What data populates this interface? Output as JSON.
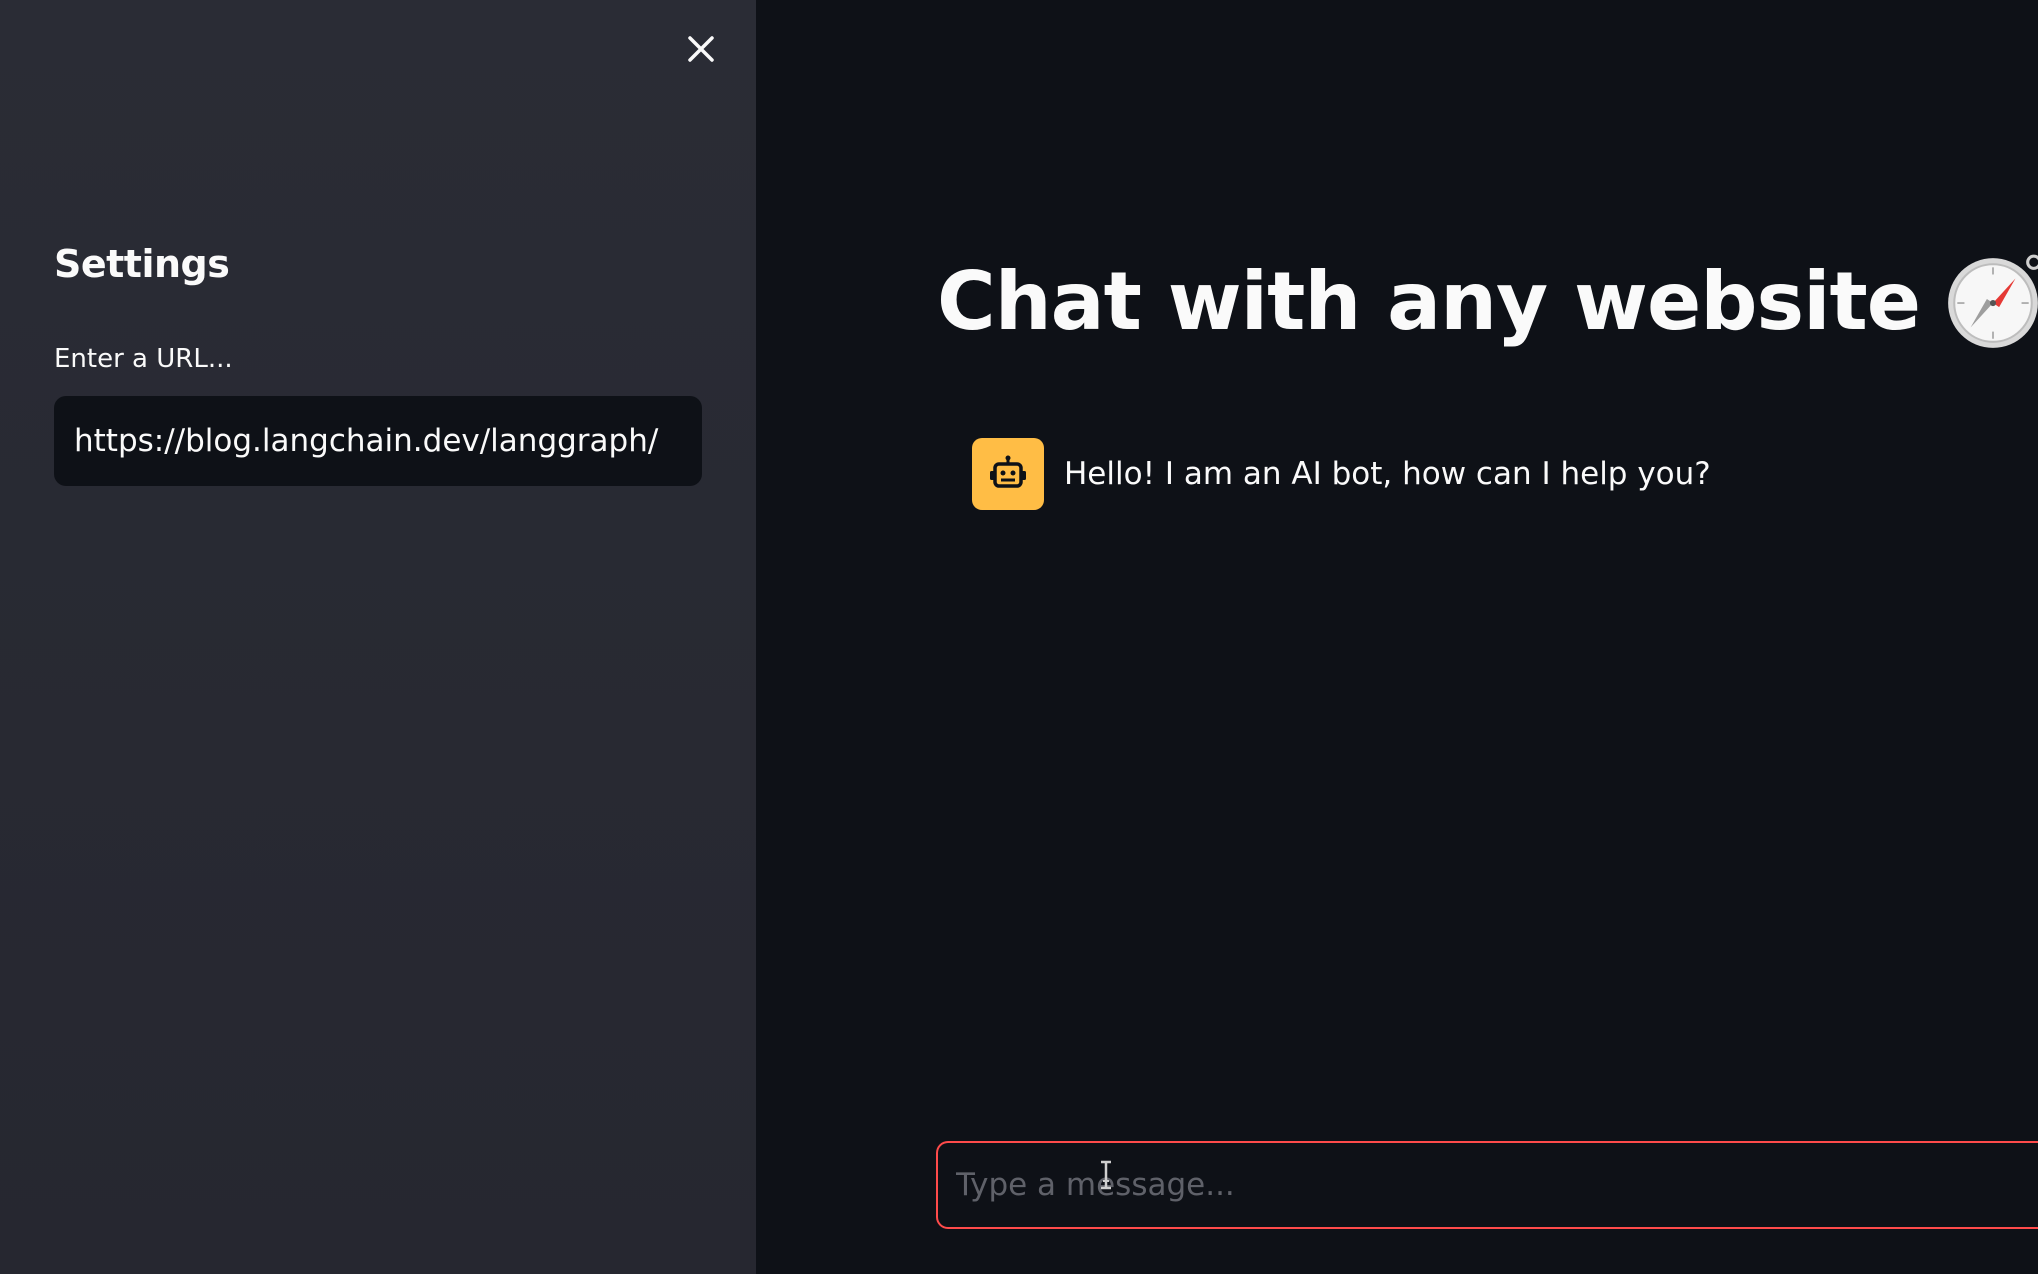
{
  "sidebar": {
    "close_icon": "close-icon",
    "title": "Settings",
    "url_label": "Enter a URL...",
    "url_value": "https://blog.langchain.dev/langgraph/"
  },
  "main": {
    "title": "Chat with any website",
    "title_icon": "compass-icon",
    "messages": [
      {
        "role": "ai",
        "avatar_icon": "robot-icon",
        "text": "Hello! I am an AI bot, how can I help you?"
      }
    ],
    "chat_input": {
      "placeholder": "Type a message..."
    }
  },
  "colors": {
    "sidebar_bg": "#262730",
    "main_bg": "#0e1117",
    "text": "#fafafa",
    "avatar_bg": "#ffbd45",
    "input_focus_border": "#ff4b4b"
  }
}
